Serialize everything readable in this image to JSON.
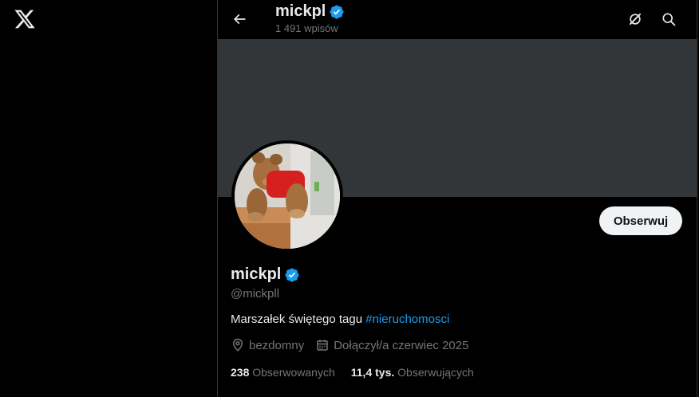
{
  "header": {
    "name": "mickpl",
    "post_count": "1 491 wpisów"
  },
  "profile": {
    "name": "mickpl",
    "handle": "@mickpll",
    "bio_text": "Marszałek świętego tagu ",
    "bio_hashtag": "#nieruchomosci",
    "location": "bezdomny",
    "joined": "Dołączył/a czerwiec 2025",
    "following_count": "238",
    "following_label": "Obserwowanych",
    "followers_count": "11,4 tys.",
    "followers_label": "Obserwujących",
    "follow_button_label": "Obserwuj"
  },
  "icons": {
    "logo": "x-logo-icon",
    "back": "arrow-left-icon",
    "grok": "grok-icon",
    "search": "search-icon",
    "verified": "verified-badge-icon",
    "location": "location-pin-icon",
    "calendar": "calendar-icon"
  },
  "colors": {
    "background": "#000000",
    "banner": "#333639",
    "accent": "#1d9bf0",
    "secondary_text": "#71767b",
    "primary_text": "#e7e9ea",
    "follow_button_bg": "#eff3f4"
  }
}
